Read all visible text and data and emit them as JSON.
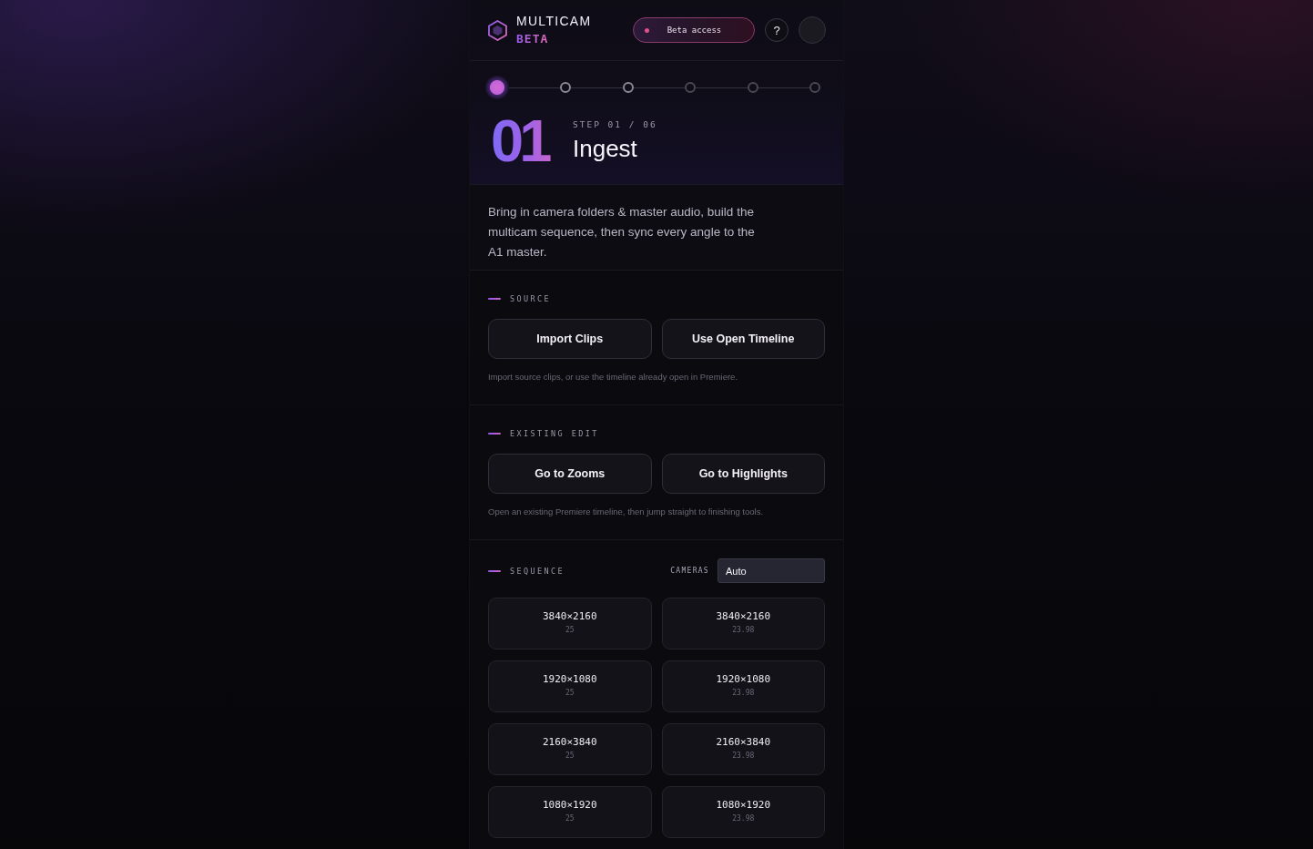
{
  "header": {
    "brand": "MULTICAM",
    "badge": "BETA",
    "access_pill": {
      "label": "Beta access"
    },
    "help_button": "?"
  },
  "stepper": [
    {
      "selected": true,
      "disabled": false
    },
    {
      "selected": false,
      "disabled": false
    },
    {
      "selected": false,
      "disabled": false
    },
    {
      "selected": false,
      "disabled": true
    },
    {
      "selected": false,
      "disabled": true
    },
    {
      "selected": false,
      "disabled": true
    }
  ],
  "step": {
    "number": "01",
    "counter": "STEP 01 / 06",
    "title": "Ingest"
  },
  "description": "Bring in camera folders & master audio, build the multicam sequence, then sync every angle to the A1 master.",
  "sections": [
    {
      "kind": "actions",
      "label": "SOURCE",
      "buttons": [
        "Import Clips",
        "Use Open Timeline"
      ],
      "hint": "Import source clips, or use the timeline already open in Premiere."
    },
    {
      "kind": "actions",
      "label": "EXISTING EDIT",
      "buttons": [
        "Go to Zooms",
        "Go to Highlights"
      ],
      "hint": "Open an existing Premiere timeline, then jump straight to finishing tools."
    },
    {
      "kind": "presets",
      "label": "SEQUENCE",
      "cameras": {
        "label": "CAMERAS",
        "value": "Auto"
      },
      "presets": [
        {
          "resolution": "3840×2160",
          "fps": "25",
          "selected": false
        },
        {
          "resolution": "3840×2160",
          "fps": "23.98",
          "selected": false
        },
        {
          "resolution": "1920×1080",
          "fps": "25",
          "selected": false
        },
        {
          "resolution": "1920×1080",
          "fps": "23.98",
          "selected": false
        },
        {
          "resolution": "2160×3840",
          "fps": "25",
          "selected": false
        },
        {
          "resolution": "2160×3840",
          "fps": "23.98",
          "selected": false
        },
        {
          "resolution": "1080×1920",
          "fps": "25",
          "selected": false
        },
        {
          "resolution": "1080×1920",
          "fps": "23.98",
          "selected": false
        }
      ]
    }
  ]
}
